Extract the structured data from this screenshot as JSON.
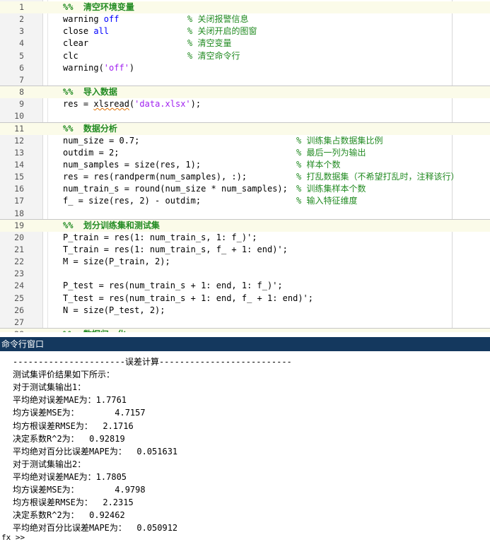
{
  "editor": {
    "lines": [
      {
        "n": "1",
        "kind": "header",
        "code": "%%  清空环境变量",
        "comment": ""
      },
      {
        "n": "2",
        "kind": "code",
        "code": "warning off",
        "comment": "% 关闭报警信息"
      },
      {
        "n": "3",
        "kind": "code",
        "code": "close all",
        "comment": "% 关闭开启的图窗"
      },
      {
        "n": "4",
        "kind": "code",
        "code": "clear",
        "comment": "% 清空变量"
      },
      {
        "n": "5",
        "kind": "code",
        "code": "clc",
        "comment": "% 清空命令行"
      },
      {
        "n": "6",
        "kind": "code",
        "code": "warning('off')",
        "comment": ""
      },
      {
        "n": "7",
        "kind": "blank",
        "code": "",
        "comment": ""
      },
      {
        "n": "8",
        "kind": "header",
        "code": "%%  导入数据",
        "comment": ""
      },
      {
        "n": "9",
        "kind": "code",
        "code": "res = xlsread('data.xlsx');",
        "comment": ""
      },
      {
        "n": "10",
        "kind": "blank",
        "code": "",
        "comment": ""
      },
      {
        "n": "11",
        "kind": "header",
        "code": "%%  数据分析",
        "comment": ""
      },
      {
        "n": "12",
        "kind": "code",
        "code": "num_size = 0.7;",
        "comment": "% 训练集占数据集比例"
      },
      {
        "n": "13",
        "kind": "code",
        "code": "outdim = 2;",
        "comment": "% 最后一列为输出"
      },
      {
        "n": "14",
        "kind": "code",
        "code": "num_samples = size(res, 1);",
        "comment": "% 样本个数"
      },
      {
        "n": "15",
        "kind": "code",
        "code": "res = res(randperm(num_samples), :);",
        "comment": "% 打乱数据集（不希望打乱时，注释该行）"
      },
      {
        "n": "16",
        "kind": "code",
        "code": "num_train_s = round(num_size * num_samples);",
        "comment": "% 训练集样本个数"
      },
      {
        "n": "17",
        "kind": "code",
        "code": "f_ = size(res, 2) - outdim;",
        "comment": "% 输入特征维度"
      },
      {
        "n": "18",
        "kind": "blank",
        "code": "",
        "comment": ""
      },
      {
        "n": "19",
        "kind": "header",
        "code": "%%  划分训练集和测试集",
        "comment": ""
      },
      {
        "n": "20",
        "kind": "code",
        "code": "P_train = res(1: num_train_s, 1: f_)';",
        "comment": ""
      },
      {
        "n": "21",
        "kind": "code",
        "code": "T_train = res(1: num_train_s, f_ + 1: end)';",
        "comment": ""
      },
      {
        "n": "22",
        "kind": "code",
        "code": "M = size(P_train, 2);",
        "comment": ""
      },
      {
        "n": "23",
        "kind": "blank",
        "code": "",
        "comment": ""
      },
      {
        "n": "24",
        "kind": "code",
        "code": "P_test = res(num_train_s + 1: end, 1: f_)';",
        "comment": ""
      },
      {
        "n": "25",
        "kind": "code",
        "code": "T_test = res(num_train_s + 1: end, f_ + 1: end)';",
        "comment": ""
      },
      {
        "n": "26",
        "kind": "code",
        "code": "N = size(P_test, 2);",
        "comment": ""
      },
      {
        "n": "27",
        "kind": "blank",
        "code": "",
        "comment": ""
      },
      {
        "n": "28",
        "kind": "header",
        "code": "%%  数据归一化",
        "comment": ""
      }
    ]
  },
  "command_window": {
    "title": "命令行窗口",
    "output": [
      "----------------------误差计算--------------------------",
      "测试集评价结果如下所示：",
      "对于测试集输出1：",
      "平均绝对误差MAE为：1.7761",
      "均方误差MSE为：       4.7157",
      "均方根误差RMSE为：  2.1716",
      "决定系数R^2为：  0.92819",
      "平均绝对百分比误差MAPE为：  0.051631",
      "对于测试集输出2：",
      "平均绝对误差MAE为：1.7805",
      "均方误差MSE为：       4.9798",
      "均方根误差RMSE为：  2.2315",
      "决定系数R^2为：  0.92462",
      "平均绝对百分比误差MAPE为：  0.050912"
    ],
    "prompt": "fx >>"
  },
  "colors": {
    "comment": "#228b22",
    "keyword": "#0000ff",
    "string": "#a020f0",
    "cell_header_bg": "#fbfbe9",
    "title_bar_bg": "#14385e"
  }
}
